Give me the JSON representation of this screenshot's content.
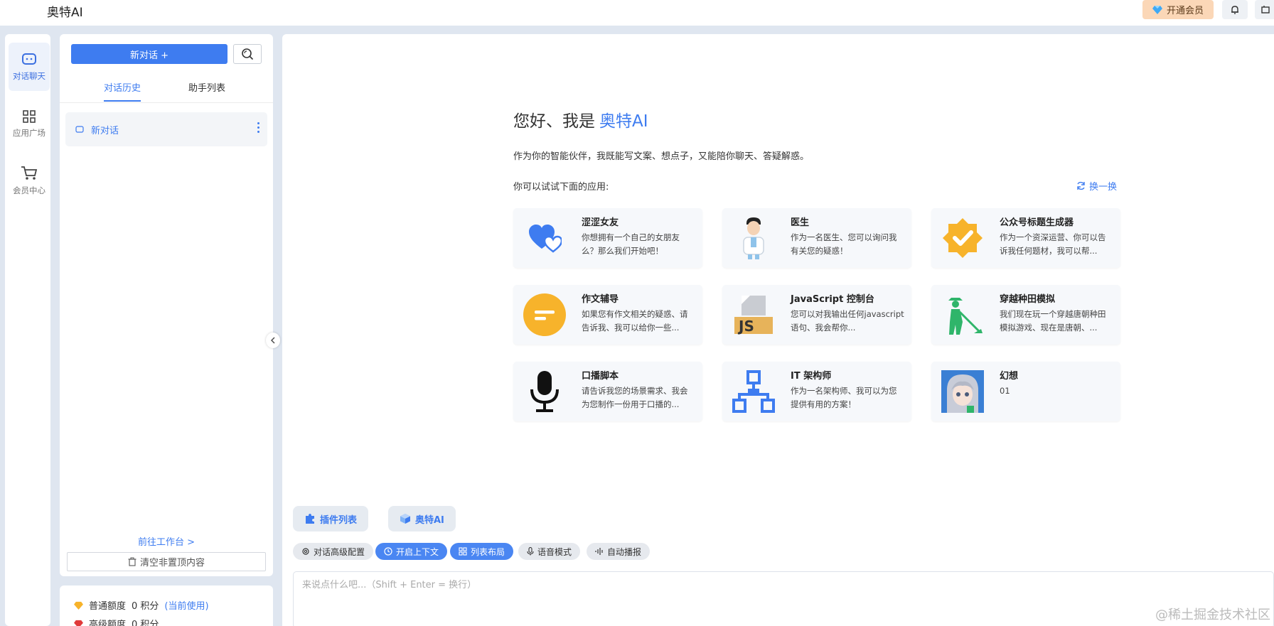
{
  "app": {
    "title": "奥特AI"
  },
  "topbar": {
    "vip_label": "开通会员",
    "colors": {
      "vip_bg": "#fbd7b7",
      "accent": "#3e7cf0"
    }
  },
  "nav": {
    "items": [
      {
        "label": "对话聊天",
        "icon": "chat-bubble-icon",
        "active": true
      },
      {
        "label": "应用广场",
        "icon": "grid-icon",
        "active": false
      },
      {
        "label": "会员中心",
        "icon": "cart-icon",
        "active": false
      }
    ]
  },
  "sidebar": {
    "new_chat_label": "新对话 +",
    "tabs": [
      {
        "label": "对话历史"
      },
      {
        "label": "助手列表"
      }
    ],
    "conversations": [
      {
        "title": "新对话"
      }
    ],
    "workbench_link": "前往工作台 >",
    "clear_label": "清空非置顶内容"
  },
  "quota": {
    "normal": {
      "label": "普通额度",
      "value": "0 积分",
      "note": "(当前使用)"
    },
    "advanced": {
      "label": "高级额度",
      "value": "0 积分"
    }
  },
  "main": {
    "greeting_prefix": "您好、我是",
    "greeting_name": "奥特AI",
    "intro": "作为你的智能伙伴，我既能写文案、想点子，又能陪你聊天、答疑解惑。",
    "try_label": "你可以试试下面的应用:",
    "refresh_label": "换一换",
    "apps": [
      {
        "title": "涩涩女友",
        "desc": "你想拥有一个自己的女朋友么？那么我们开始吧！",
        "icon": "heart-icon"
      },
      {
        "title": "医生",
        "desc": "作为一名医生、您可以询问我有关您的疑惑！",
        "icon": "doctor-icon"
      },
      {
        "title": "公众号标题生成器",
        "desc": "作为一个资深运营、你可以告诉我任何题材，我可以帮...",
        "icon": "verified-badge-icon"
      },
      {
        "title": "作文辅导",
        "desc": "如果您有作文相关的疑惑、请告诉我、我可以给你一些...",
        "icon": "text-lines-icon"
      },
      {
        "title": "JavaScript 控制台",
        "desc": "您可以对我输出任何javascript语句、我会帮你...",
        "icon": "js-file-icon"
      },
      {
        "title": "穿越种田模拟",
        "desc": "我们现在玩一个穿越唐朝种田模拟游戏、现在是唐朝、...",
        "icon": "farmer-icon"
      },
      {
        "title": "口播脚本",
        "desc": "请告诉我您的场景需求、我会为您制作一份用于口播的...",
        "icon": "microphone-icon"
      },
      {
        "title": "IT 架构师",
        "desc": "作为一名架构师、我可以为您提供有用的方案！",
        "icon": "network-icon"
      },
      {
        "title": "幻想",
        "desc": "01",
        "icon": "anime-avatar-icon"
      }
    ]
  },
  "toolbar": {
    "plugins_label": "插件列表",
    "model_label": "奥特AI",
    "chips": [
      {
        "label": "对话高级配置",
        "on": false
      },
      {
        "label": "开启上下文",
        "on": true
      },
      {
        "label": "列表布局",
        "on": true
      },
      {
        "label": "语音模式",
        "on": false
      },
      {
        "label": "自动播报",
        "on": false
      }
    ],
    "input_placeholder": "来说点什么吧...（Shift + Enter = 换行）"
  },
  "watermark": "@稀土掘金技术社区"
}
